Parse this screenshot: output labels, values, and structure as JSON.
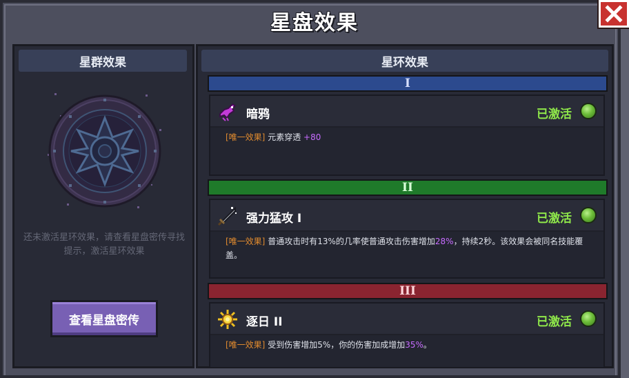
{
  "window": {
    "title": "星盘效果"
  },
  "left": {
    "header": "星群效果",
    "hint": "还未激活星环效果，请查看星盘密传寻找提示，激活星环效果",
    "button": "查看星盘密传"
  },
  "right": {
    "header": "星环效果",
    "tiers": [
      {
        "numeral": "I",
        "color": "#2c4a8e",
        "skill": "暗鸦",
        "icon": "purple-crow-icon",
        "status": "已激活",
        "tag": "[唯一效果]",
        "desc_parts": [
          "元素穿透 ",
          "+80",
          ""
        ]
      },
      {
        "numeral": "II",
        "color": "#1f7a2a",
        "skill": "强力猛攻 I",
        "icon": "sword-icon",
        "status": "已激活",
        "tag": "[唯一效果]",
        "desc_parts": [
          "普通攻击时有13%的几率使普通攻击伤害增加",
          "28%",
          "，持续2秒。该效果会被同名技能覆盖。"
        ]
      },
      {
        "numeral": "III",
        "color": "#8a2430",
        "skill": "逐日 II",
        "icon": "sun-icon",
        "status": "已激活",
        "tag": "[唯一效果]",
        "desc_parts": [
          "受到伤害增加5%，你的伤害加成增加",
          "35%",
          "。"
        ]
      }
    ]
  }
}
